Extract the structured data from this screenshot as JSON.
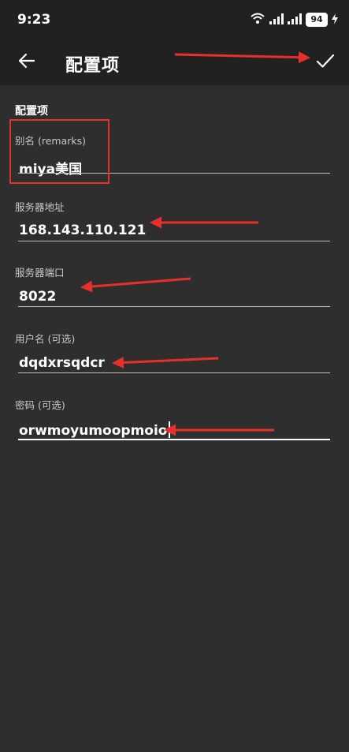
{
  "status_bar": {
    "time": "9:23",
    "battery": "94",
    "icons": [
      "wifi-icon",
      "signal-icon",
      "signal-icon",
      "battery-icon",
      "charging-icon"
    ]
  },
  "toolbar": {
    "back_icon": "arrow-left-icon",
    "title": "配置项",
    "confirm_icon": "check-icon"
  },
  "form": {
    "section_title": "配置项",
    "fields": [
      {
        "label": "别名 (remarks)",
        "value": "miya美国"
      },
      {
        "label": "服务器地址",
        "value": "168.143.110.121"
      },
      {
        "label": "服务器端口",
        "value": "8022"
      },
      {
        "label": "用户名 (可选)",
        "value": "dqdxrsqdcr"
      },
      {
        "label": "密码 (可选)",
        "value": "orwmoyumoopmoio"
      }
    ]
  },
  "colors": {
    "background": "#2e2e2e",
    "bar": "#212121",
    "annotation_red": "#e5302b"
  }
}
